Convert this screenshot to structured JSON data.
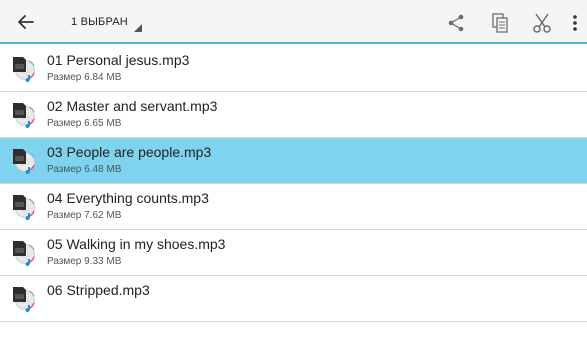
{
  "toolbar": {
    "back_icon": "arrow-left-icon",
    "selection_label": "1 ВЫБРАН",
    "actions": [
      {
        "name": "share",
        "icon": "share-icon"
      },
      {
        "name": "copy",
        "icon": "copy-icon"
      },
      {
        "name": "cut",
        "icon": "scissors-icon"
      },
      {
        "name": "more",
        "icon": "more-vertical-icon"
      }
    ],
    "accent_color": "#4fb7c6"
  },
  "files": [
    {
      "name": "01 Personal jesus.mp3",
      "size": "Размер 6.84 MB",
      "selected": false
    },
    {
      "name": "02 Master and servant.mp3",
      "size": "Размер 6.65 MB",
      "selected": false
    },
    {
      "name": "03 People are people.mp3",
      "size": "Размер 6.48 MB",
      "selected": true
    },
    {
      "name": "04 Everything counts.mp3",
      "size": "Размер 7.62 MB",
      "selected": false
    },
    {
      "name": "05 Walking in my shoes.mp3",
      "size": "Размер 9.33 MB",
      "selected": false
    },
    {
      "name": "06 Stripped.mp3",
      "size": "",
      "selected": false
    }
  ],
  "colors": {
    "selected_row": "#80d3ee",
    "divider": "#d6d6d6"
  }
}
